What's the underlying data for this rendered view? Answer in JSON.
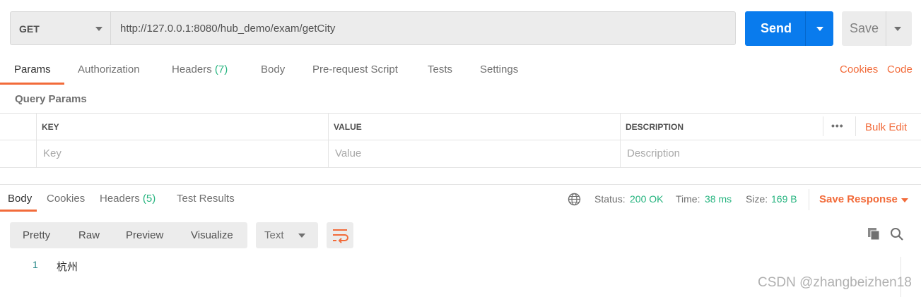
{
  "request": {
    "method": "GET",
    "url": "http://127.0.0.1:8080/hub_demo/exam/getCity",
    "send_label": "Send",
    "save_label": "Save"
  },
  "request_tabs": {
    "params": "Params",
    "authorization": "Authorization",
    "headers": "Headers",
    "headers_count": "(7)",
    "body": "Body",
    "prerequest": "Pre-request Script",
    "tests": "Tests",
    "settings": "Settings",
    "cookies_link": "Cookies",
    "code_link": "Code"
  },
  "query_params": {
    "title": "Query Params",
    "columns": {
      "key": "KEY",
      "value": "VALUE",
      "description": "DESCRIPTION"
    },
    "more_icon": "•••",
    "bulk_edit": "Bulk Edit",
    "placeholders": {
      "key": "Key",
      "value": "Value",
      "description": "Description"
    }
  },
  "response": {
    "tabs": {
      "body": "Body",
      "cookies": "Cookies",
      "headers": "Headers",
      "headers_count": "(5)",
      "test_results": "Test Results"
    },
    "status_label": "Status:",
    "status_value": "200 OK",
    "time_label": "Time:",
    "time_value": "38 ms",
    "size_label": "Size:",
    "size_value": "169 B",
    "save_response": "Save Response",
    "format_tabs": [
      "Pretty",
      "Raw",
      "Preview",
      "Visualize"
    ],
    "format_type": "Text",
    "lines": [
      {
        "num": "1",
        "text": "杭州"
      }
    ]
  },
  "watermark": "CSDN @zhangbeizhen18",
  "colors": {
    "accent": "#f26b3a",
    "send": "#097bed",
    "success": "#26b47f"
  },
  "icons": [
    "chevron-down-icon",
    "globe-icon",
    "wrap-lines-icon",
    "copy-icon",
    "search-icon",
    "more-icon"
  ]
}
